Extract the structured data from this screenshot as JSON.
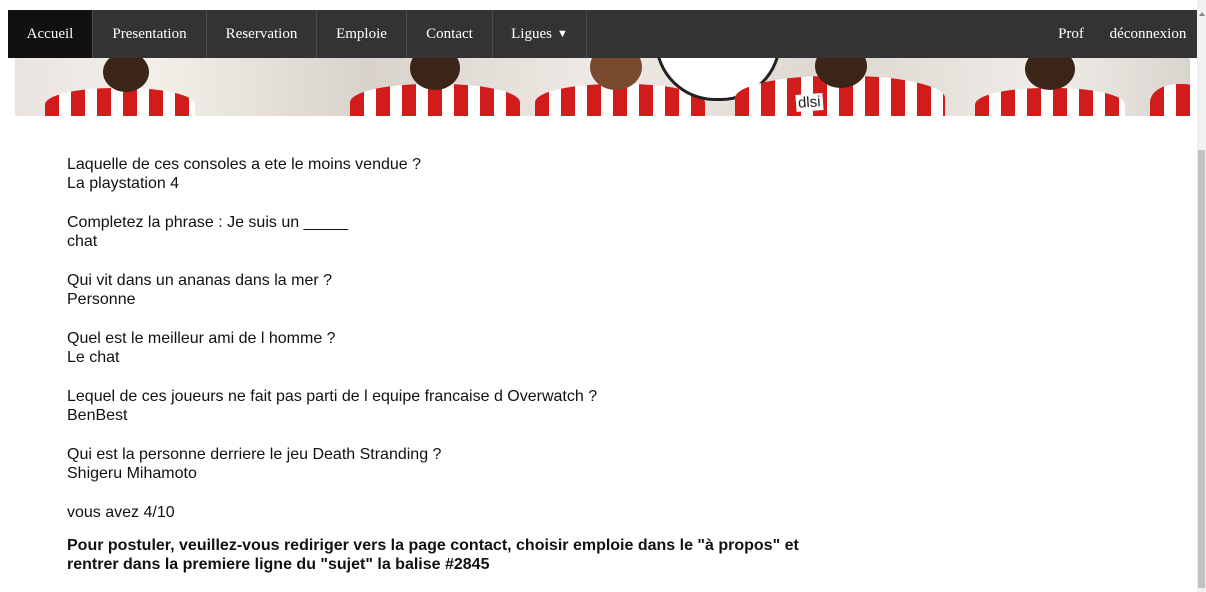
{
  "nav": {
    "items": [
      {
        "label": "Accueil",
        "active": true
      },
      {
        "label": "Presentation"
      },
      {
        "label": "Reservation"
      },
      {
        "label": "Emploie"
      },
      {
        "label": "Contact"
      },
      {
        "label": "Ligues"
      }
    ],
    "ligues_caret": "▼",
    "right_items": [
      {
        "label": "Prof"
      },
      {
        "label": "déconnexion"
      }
    ]
  },
  "banner": {
    "sponsor_text": "dlsi"
  },
  "quiz": [
    {
      "question": "Laquelle de ces consoles a ete le moins vendue ?",
      "answer": "La playstation 4"
    },
    {
      "question": "Completez la phrase : Je suis un _____",
      "answer": "chat"
    },
    {
      "question": "Qui vit dans un ananas dans la mer ?",
      "answer": "Personne"
    },
    {
      "question": "Quel est le meilleur ami de l homme ?",
      "answer": "Le chat"
    },
    {
      "question": "Lequel de ces joueurs ne fait pas parti de l equipe francaise d Overwatch ?",
      "answer": "BenBest"
    },
    {
      "question": "Qui est la personne derriere le jeu Death Stranding ?",
      "answer": "Shigeru Mihamoto"
    }
  ],
  "score_text": "vous avez 4/10",
  "note_text": "Pour postuler, veuillez-vous rediriger vers la page contact, choisir emploie dans le \"à propos\" et rentrer dans la premiere ligne du \"sujet\" la balise #2845",
  "colors": {
    "navbar_bg": "#333333",
    "navbar_active_bg": "#111111",
    "nav_text": "#ffffff",
    "shirt_red": "#d21c1c"
  }
}
